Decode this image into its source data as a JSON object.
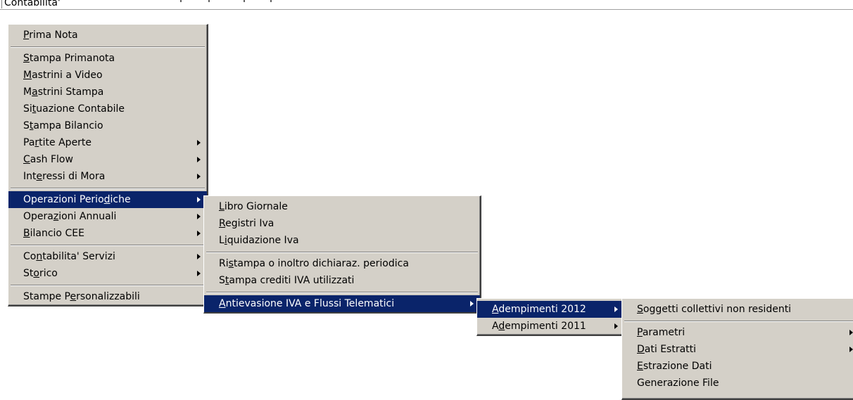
{
  "menubar": {
    "title": "Contabilita'"
  },
  "main_menu": {
    "items": [
      {
        "pre": "",
        "key": "P",
        "post": "rima Nota",
        "arrow": false
      },
      "sep",
      {
        "pre": "",
        "key": "S",
        "post": "tampa Primanota",
        "arrow": false
      },
      {
        "pre": "",
        "key": "M",
        "post": "astrini a Video",
        "arrow": false
      },
      {
        "pre": "M",
        "key": "a",
        "post": "strini Stampa",
        "arrow": false
      },
      {
        "pre": "Si",
        "key": "t",
        "post": "uazione Contabile",
        "arrow": false
      },
      {
        "pre": "S",
        "key": "t",
        "post": "ampa Bilancio",
        "arrow": false
      },
      {
        "pre": "Pa",
        "key": "r",
        "post": "tite Aperte",
        "arrow": true
      },
      {
        "pre": "",
        "key": "C",
        "post": "ash Flow",
        "arrow": true
      },
      {
        "pre": "Int",
        "key": "e",
        "post": "ressi di Mora",
        "arrow": true
      },
      "sep",
      {
        "pre": "Operazioni Perio",
        "key": "d",
        "post": "iche",
        "arrow": true,
        "selected": true
      },
      {
        "pre": "Opera",
        "key": "z",
        "post": "ioni Annuali",
        "arrow": true
      },
      {
        "pre": "",
        "key": "B",
        "post": "ilancio CEE",
        "arrow": true
      },
      "sep",
      {
        "pre": "Co",
        "key": "n",
        "post": "tabilita' Servizi",
        "arrow": true
      },
      {
        "pre": "St",
        "key": "o",
        "post": "rico",
        "arrow": true
      },
      "sep",
      {
        "pre": "Stampe P",
        "key": "e",
        "post": "rsonalizzabili",
        "arrow": false
      }
    ]
  },
  "periodiche_menu": {
    "items": [
      {
        "pre": "",
        "key": "L",
        "post": "ibro Giornale",
        "arrow": false
      },
      {
        "pre": "",
        "key": "R",
        "post": "egistri Iva",
        "arrow": false
      },
      {
        "pre": "L",
        "key": "i",
        "post": "quidazione Iva",
        "arrow": false
      },
      "sep",
      {
        "pre": "Ri",
        "key": "s",
        "post": "tampa o inoltro dichiaraz. periodica",
        "arrow": false
      },
      {
        "pre": "S",
        "key": "t",
        "post": "ampa crediti IVA utilizzati",
        "arrow": false
      },
      "sep",
      {
        "pre": "",
        "key": "A",
        "post": "ntievasione IVA e Flussi Telematici",
        "arrow": true,
        "selected": true
      }
    ]
  },
  "antievasione_menu": {
    "items": [
      {
        "pre": "",
        "key": "A",
        "post": "dempimenti 2012",
        "arrow": true,
        "selected": true
      },
      {
        "pre": "A",
        "key": "d",
        "post": "empimenti 2011",
        "arrow": true
      }
    ]
  },
  "adempimenti2012_menu": {
    "items": [
      {
        "pre": "",
        "key": "S",
        "post": "oggetti collettivi non residenti",
        "arrow": false
      },
      "sep",
      {
        "pre": "",
        "key": "P",
        "post": "arametri",
        "arrow": true
      },
      {
        "pre": "",
        "key": "D",
        "post": "ati Estratti",
        "arrow": true
      },
      {
        "pre": "",
        "key": "E",
        "post": "strazione Dati",
        "arrow": false
      },
      {
        "pre": "Generazione File",
        "key": "",
        "post": "",
        "arrow": false
      }
    ]
  }
}
